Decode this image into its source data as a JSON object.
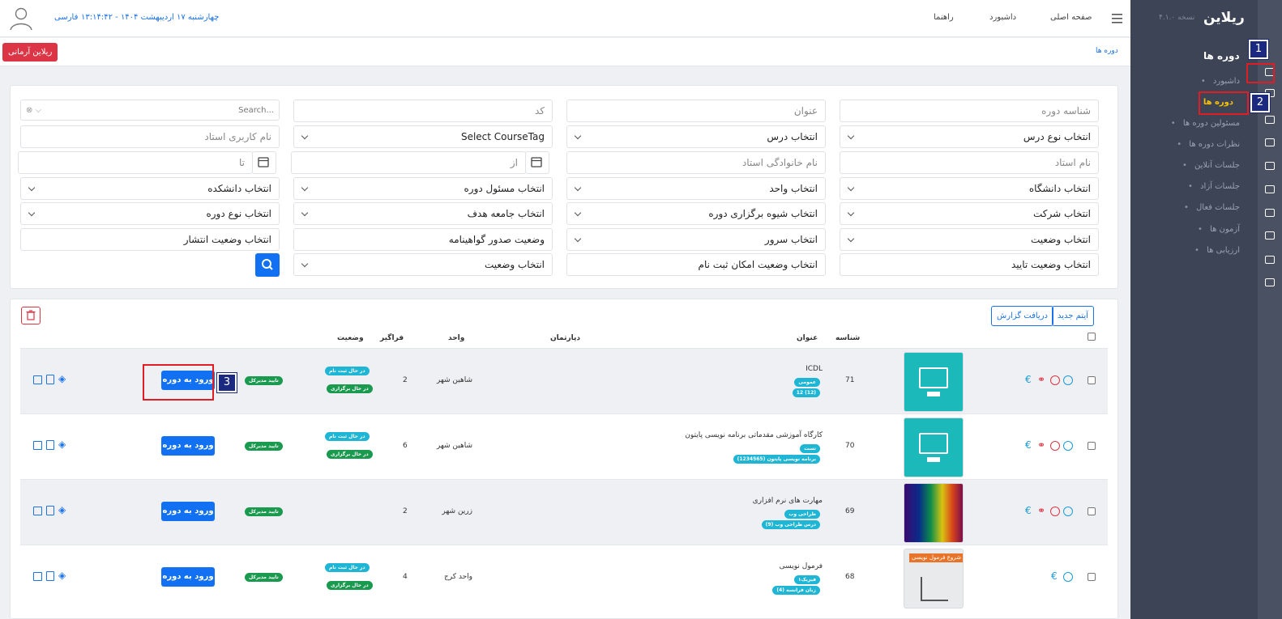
{
  "header": {
    "lang": "فارسی",
    "datetime": "چهارشنبه ۱۷ اردیبهشت ۱۴۰۴ - ۱۳:۱۴:۴۲",
    "nav": [
      "صفحه اصلی",
      "داشبورد",
      "راهنما"
    ]
  },
  "breadcrumb": {
    "item": "دوره ها",
    "badge": "ریلاین آرمانی"
  },
  "sidebar": {
    "brand": "ریلاین",
    "version": "نسخه ۴.۱.۰",
    "section_title": "دوره ها",
    "items": [
      {
        "label": "داشبورد"
      },
      {
        "label": "دوره ها"
      },
      {
        "label": "مسئولین دوره ها"
      },
      {
        "label": "نظرات دوره ها"
      },
      {
        "label": "جلسات آنلاین"
      },
      {
        "label": "جلسات آزاد"
      },
      {
        "label": "جلسات فعال"
      },
      {
        "label": "آزمون ها"
      },
      {
        "label": "ارزیابی ها"
      }
    ]
  },
  "filters": {
    "search": "Search...",
    "code": "کد",
    "title": "عنوان",
    "course_id": "شناسه دوره",
    "teacher_username": "نام کاربری استاد",
    "course_tag": "Select CourseTag",
    "lesson": "انتخاب درس",
    "lesson_type": "انتخاب نوع درس",
    "to": "تا",
    "from": "از",
    "teacher_lastname": "نام خانوادگی استاد",
    "teacher_name": "نام استاد",
    "faculty": "انتخاب دانشکده",
    "course_manager": "انتخاب مسئول دوره",
    "unit": "انتخاب واحد",
    "university": "انتخاب دانشگاه",
    "course_type": "انتخاب نوع دوره",
    "target_community": "انتخاب جامعه هدف",
    "holding_method": "انتخاب شیوه برگزاری دوره",
    "company": "انتخاب شرکت",
    "publish_status": "انتخاب وضعیت انتشار",
    "certificate_status": "وضعیت صدور گواهینامه",
    "server": "انتخاب سرور",
    "status": "انتخاب وضعیت",
    "status2": "انتخاب وضعیت",
    "registration_status": "انتخاب وضعیت امکان ثبت نام",
    "approval_status": "انتخاب وضعیت تایید"
  },
  "table": {
    "new_item": "آیتم جدید",
    "get_report": "دریافت گزارش",
    "headers": {
      "id": "شناسه",
      "title": "عنوان",
      "department": "دپارتمان",
      "unit": "واحد",
      "learner": "فراگیر",
      "status": "وضعیت"
    },
    "enter_label": "ورود به دوره",
    "manager_approved": "تایید مدیرکل",
    "status_registering": "در حال ثبت نام",
    "status_holding": "در حال برگزاری",
    "rows": [
      {
        "id": "71",
        "title": "ICDL",
        "tags": [
          "عمومی",
          "(12) 12"
        ],
        "unit": "شاهین شهر",
        "learners": "2",
        "statuses": true
      },
      {
        "id": "70",
        "title": "کارگاه آموزشی مقدماتی برنامه نویسی پایتون",
        "tags": [
          "تست",
          "برنامه نویسی پایتون (1234565)"
        ],
        "unit": "شاهین شهر",
        "learners": "6",
        "statuses": true
      },
      {
        "id": "69",
        "title": "مهارت های نرم افزاری",
        "tags": [
          "طراحی وب",
          "درس طراحی وب (9)"
        ],
        "unit": "زرین شهر",
        "learners": "2",
        "statuses": false
      },
      {
        "id": "68",
        "title": "فرمول نویسی",
        "tags": [
          "فیزیک۱",
          "زبان فرانسه (4)"
        ],
        "unit": "واحد کرج",
        "learners": "4",
        "statuses": true,
        "thumb_text": "شروع فرمول نویسی"
      }
    ]
  },
  "annotations": [
    "1",
    "2",
    "3"
  ]
}
